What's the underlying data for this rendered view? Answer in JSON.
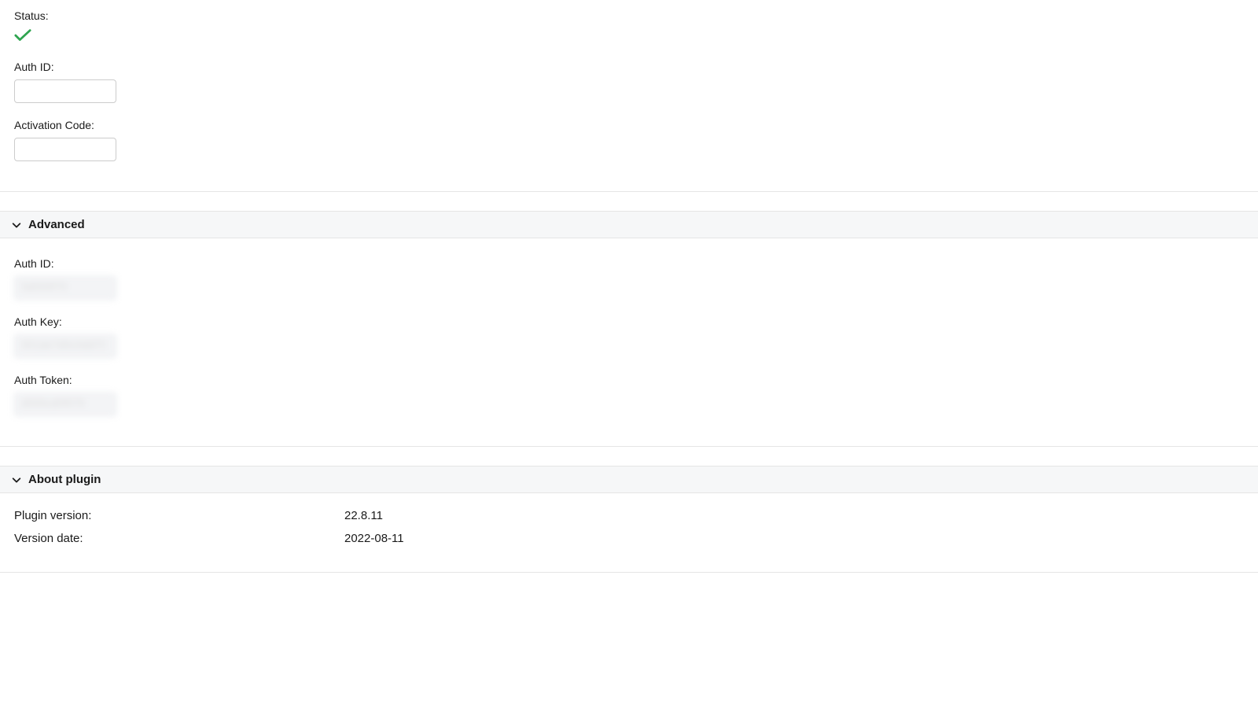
{
  "top": {
    "status_label": "Status:",
    "auth_id_label": "Auth ID:",
    "auth_id_value": "",
    "activation_code_label": "Activation Code:",
    "activation_code_value": ""
  },
  "advanced": {
    "title": "Advanced",
    "auth_id_label": "Auth ID:",
    "auth_id_value": "5d000f70",
    "auth_key_label": "Auth Key:",
    "auth_key_value": "001de7d0c0dd70",
    "auth_token_label": "Auth Token:",
    "auth_token_value": "d000cd0f070"
  },
  "about": {
    "title": "About plugin",
    "plugin_version_label": "Plugin version:",
    "plugin_version_value": "22.8.11",
    "version_date_label": "Version date:",
    "version_date_value": "2022-08-11"
  }
}
